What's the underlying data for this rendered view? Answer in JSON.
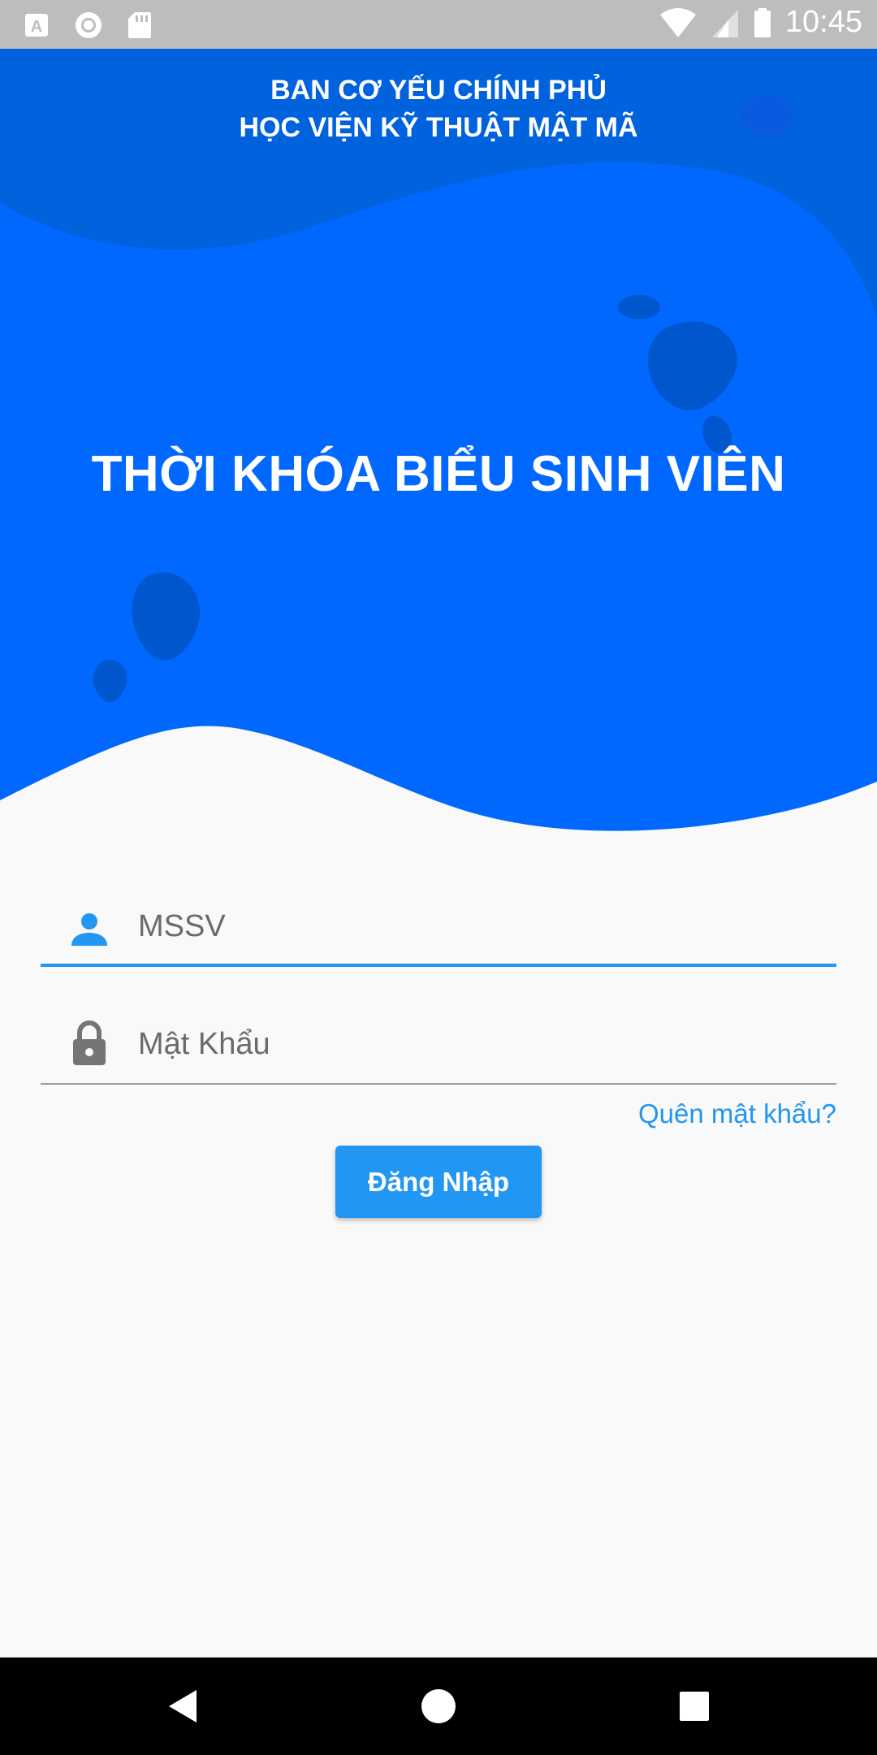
{
  "status_bar": {
    "time": "10:45",
    "icons": [
      "a-notification-icon",
      "circle-notification-icon",
      "sd-card-icon",
      "wifi-icon",
      "signal-icon",
      "battery-icon"
    ]
  },
  "header": {
    "line1": "BAN CƠ YẾU CHÍNH PHỦ",
    "line2": "HỌC VIỆN KỸ THUẬT MẬT MÃ"
  },
  "app_title": "THỜI KHÓA BIỂU SINH VIÊN",
  "form": {
    "username_placeholder": "MSSV",
    "password_placeholder": "Mật Khẩu",
    "forgot_label": "Quên mật khẩu?",
    "login_label": "Đăng Nhập"
  },
  "colors": {
    "primary": "#2196f3",
    "hero_dark": "#0062dd",
    "hero_light": "#0068ff",
    "blob": "#0056cc",
    "background": "#f9f9f9"
  },
  "nav_bar": {
    "icons": [
      "back-icon",
      "home-icon",
      "recents-icon"
    ]
  }
}
